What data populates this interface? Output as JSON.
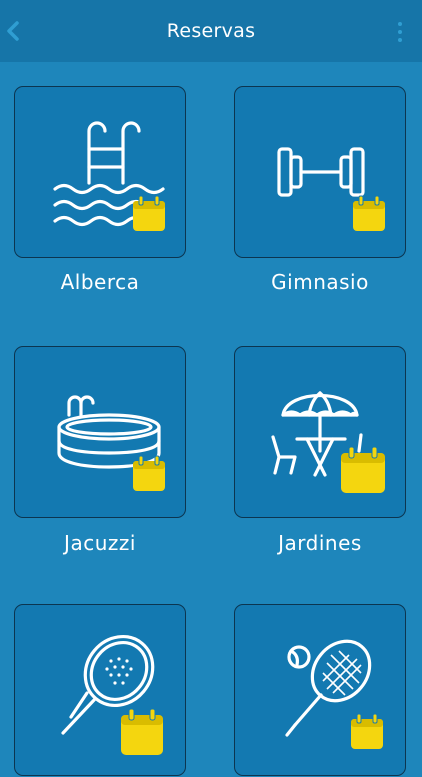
{
  "header": {
    "title": "Reservas",
    "back_icon": "chevron-left-icon",
    "menu_icon": "more-vertical-icon"
  },
  "colors": {
    "background": "#1e86bb",
    "header": "#1675a8",
    "card": "#1379b1",
    "accent_calendar": "#f4d60f",
    "text": "#ffffff"
  },
  "facilities": [
    {
      "label": "Alberca",
      "icon": "pool-ladder-icon"
    },
    {
      "label": "Gimnasio",
      "icon": "dumbbell-icon"
    },
    {
      "label": "Jacuzzi",
      "icon": "jacuzzi-icon"
    },
    {
      "label": "Jardines",
      "icon": "garden-umbrella-icon"
    },
    {
      "label": "",
      "icon": "padel-racket-icon"
    },
    {
      "label": "",
      "icon": "tennis-racket-icon"
    }
  ]
}
